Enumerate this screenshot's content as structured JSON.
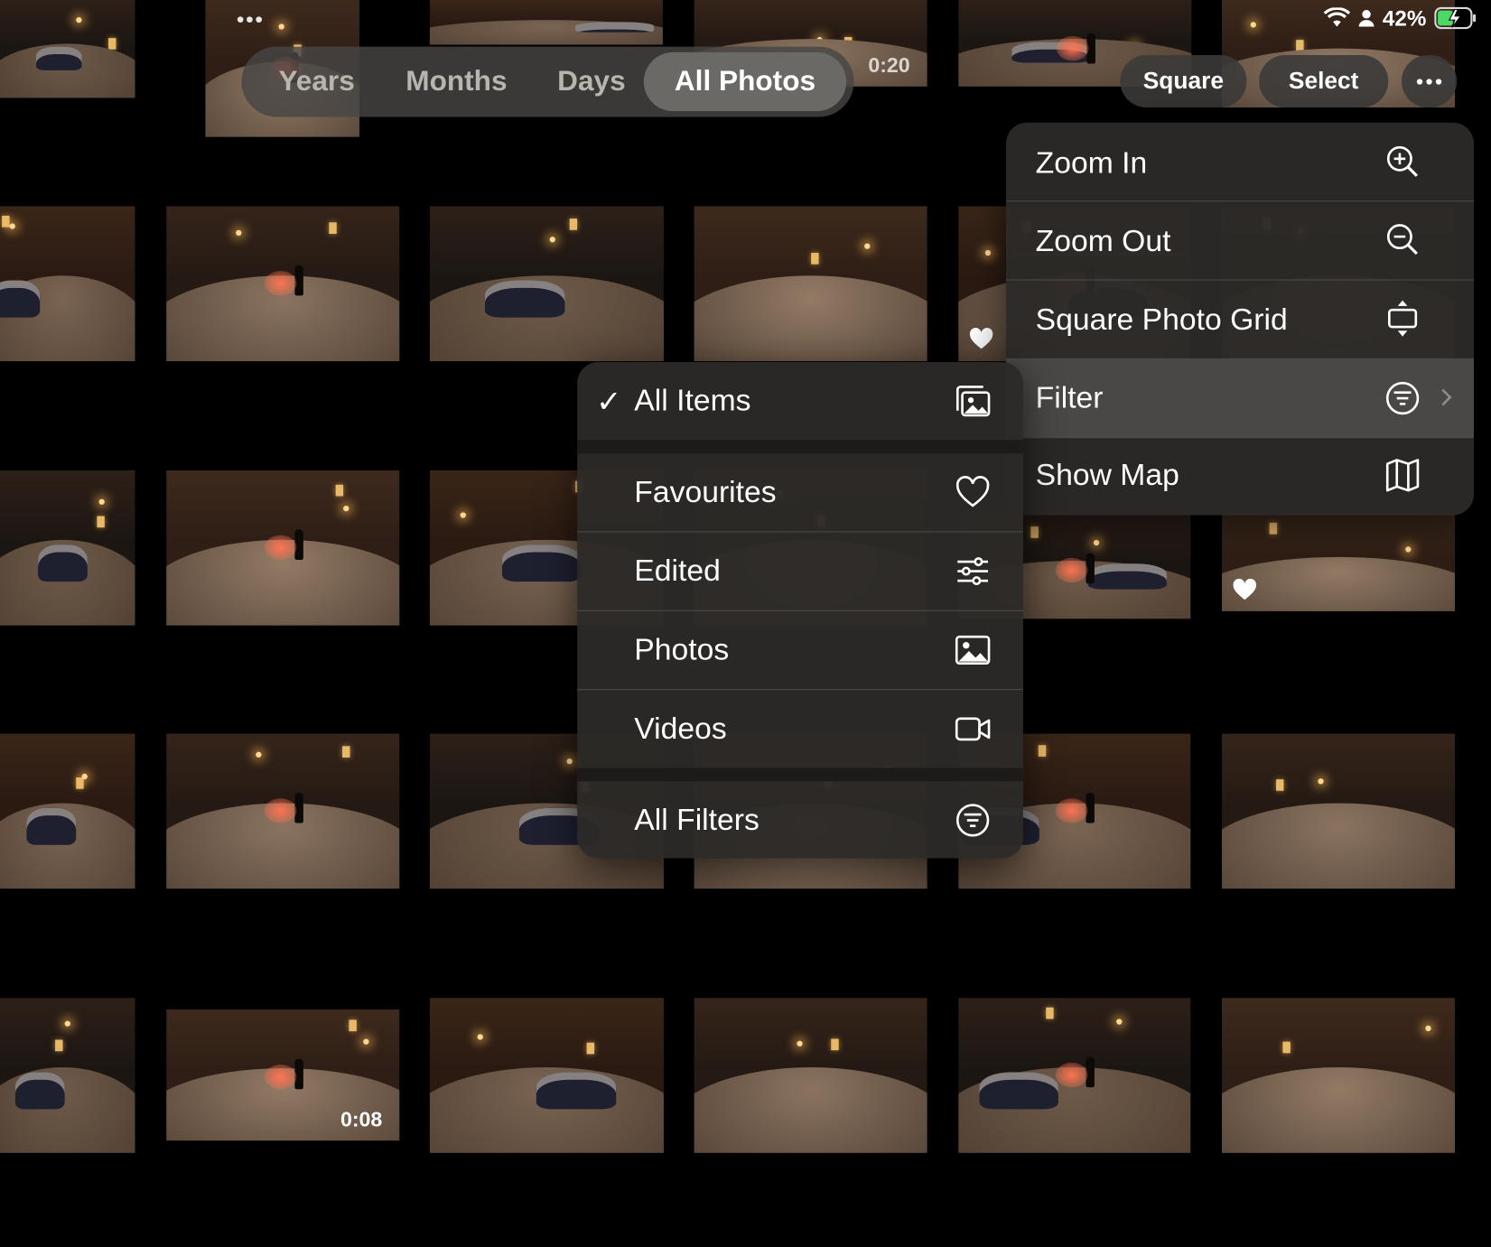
{
  "status_bar": {
    "battery": "42%"
  },
  "segmented_control": {
    "tabs": [
      "Years",
      "Months",
      "Days",
      "All Photos"
    ],
    "selected": "All Photos"
  },
  "toolbar": {
    "square_label": "Square",
    "select_label": "Select",
    "more_icon": "ellipsis-icon"
  },
  "top_dots": "•••",
  "grid": {
    "video_durations": [
      "0:20",
      "0:08"
    ],
    "favourite_icon": "heart-icon"
  },
  "view_menu": {
    "items": [
      {
        "label": "Zoom In",
        "icon": "zoom-in-icon"
      },
      {
        "label": "Zoom Out",
        "icon": "zoom-out-icon"
      },
      {
        "label": "Square Photo Grid",
        "icon": "aspect-ratio-icon"
      },
      {
        "label": "Filter",
        "icon": "filter-icon",
        "has_submenu": true,
        "highlighted": true
      },
      {
        "label": "Show Map",
        "icon": "map-icon"
      }
    ]
  },
  "filter_submenu": {
    "selected": "All Items",
    "items": [
      {
        "label": "All Items",
        "icon": "photo-stack-icon",
        "checked": true
      },
      {
        "label": "Favourites",
        "icon": "heart-outline-icon"
      },
      {
        "label": "Edited",
        "icon": "sliders-icon"
      },
      {
        "label": "Photos",
        "icon": "photo-icon"
      },
      {
        "label": "Videos",
        "icon": "video-camera-icon"
      },
      {
        "label": "All Filters",
        "icon": "filter-icon"
      }
    ],
    "checkmark": "✓"
  },
  "colors": {
    "menu_bg": "#2c2a28",
    "highlight": "#4a4846",
    "accent_battery": "#4cd964"
  }
}
